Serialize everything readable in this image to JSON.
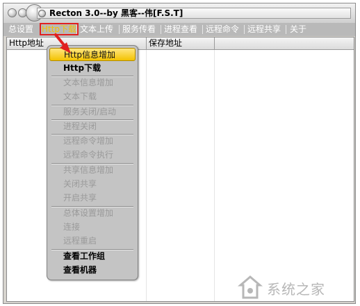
{
  "window": {
    "title": "Recton 3.0--by 黑客--伟[F.S.T]"
  },
  "menubar": {
    "items": [
      {
        "label": "总设置"
      },
      {
        "label": "Http下载"
      },
      {
        "label": "文本上传"
      },
      {
        "label": "服务传看"
      },
      {
        "label": "进程查看"
      },
      {
        "label": "远程命令"
      },
      {
        "label": "远程共享"
      },
      {
        "label": "关于"
      }
    ],
    "active_index": 1
  },
  "table": {
    "columns": [
      "Http地址",
      "保存地址"
    ]
  },
  "popup_menu": {
    "items": [
      {
        "label": "Http信息增加",
        "state": "highlighted"
      },
      {
        "label": "Http下载",
        "state": "enabled"
      },
      {
        "label": "文本信息增加",
        "state": "disabled"
      },
      {
        "label": "文本下载",
        "state": "disabled"
      },
      {
        "label": "服务关闭/启动",
        "state": "disabled"
      },
      {
        "label": "进程关闭",
        "state": "disabled"
      },
      {
        "label": "远程命令增加",
        "state": "disabled"
      },
      {
        "label": "远程命令执行",
        "state": "disabled"
      },
      {
        "label": "共享信息增加",
        "state": "disabled"
      },
      {
        "label": "关闭共享",
        "state": "disabled"
      },
      {
        "label": "开启共享",
        "state": "disabled"
      },
      {
        "label": "总体设置增加",
        "state": "disabled"
      },
      {
        "label": "连接",
        "state": "disabled"
      },
      {
        "label": "远程重启",
        "state": "disabled"
      },
      {
        "label": "查看工作组",
        "state": "enabled"
      },
      {
        "label": "查看机器",
        "state": "enabled"
      }
    ]
  },
  "watermark": {
    "text": "系统之家"
  },
  "colors": {
    "menubar_bg": "#b9b9b9",
    "active_menu_text": "#f5c000",
    "annotation_red": "#e02020",
    "highlight_gold": "#f3c200"
  }
}
